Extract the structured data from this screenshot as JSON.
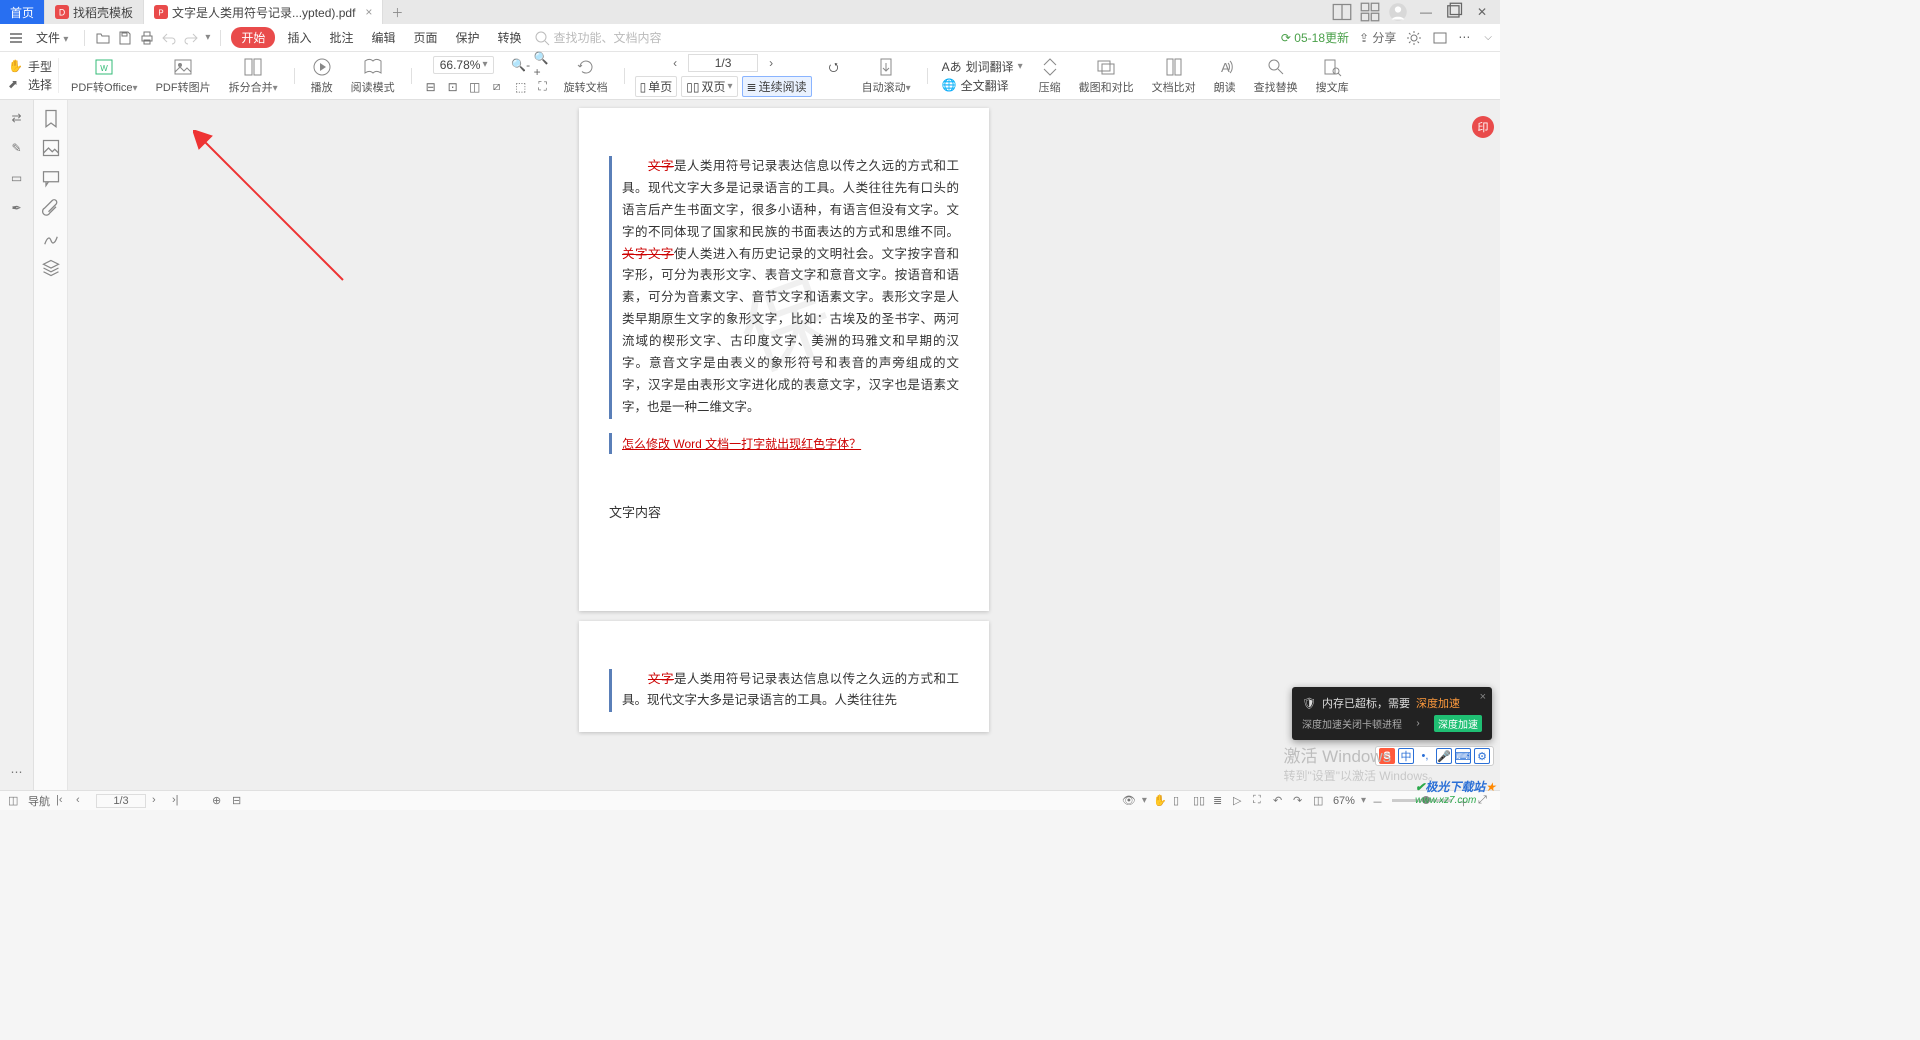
{
  "tabs": {
    "home": "首页",
    "template": "找稻壳模板",
    "doc": "文字是人类用符号记录...ypted).pdf"
  },
  "menubar": {
    "file": "文件",
    "start": "开始",
    "insert": "插入",
    "annot": "批注",
    "edit": "编辑",
    "page": "页面",
    "protect": "保护",
    "convert": "转换",
    "search_ph": "查找功能、文档内容",
    "update": "05-18更新",
    "share": "分享"
  },
  "cursor": {
    "hand": "手型",
    "select": "选择"
  },
  "ribbon": {
    "pdf2office": "PDF转Office",
    "pdf2img": "PDF转图片",
    "splitmerge": "拆分合并",
    "play": "播放",
    "readmode": "阅读模式",
    "rotate": "旋转文档",
    "zoom": "66.78%",
    "page": "1/3",
    "single": "单页",
    "double": "双页",
    "cont": "连续阅读",
    "autoscroll": "自动滚动",
    "wordtrans": "划词翻译",
    "fulltrans": "全文翻译",
    "compress": "压缩",
    "screenshot": "截图和对比",
    "filecompare": "文档比对",
    "readaloud": "朗读",
    "findreplace": "查找替换",
    "soudoc": "搜文库"
  },
  "doc": {
    "para": "是人类用符号记录表达信息以传之久远的方式和工具。现代文字大多是记录语言的工具。人类往往先有口头的语言后产生书面文字，很多小语种，有语言但没有文字。文字的不同体现了国家和民族的书面表达的方式和思维不同。",
    "red1": "文字",
    "red2": "关字文字",
    "para2": "使人类进入有历史记录的文明社会。文字按字音和字形，可分为表形文字、表音文字和意音文字。按语音和语素，可分为音素文字、音节文字和语素文字。表形文字是人类早期原生文字的象形文字，比如：古埃及的圣书字、两河流域的楔形文字、古印度文字、美洲的玛雅文和早期的汉字。意音文字是由表义的象形符号和表音的声旁组成的文字，汉字是由表形文字进化成的表意文字，汉字也是语素文字，也是一种二维文字。",
    "link": "怎么修改 Word 文档一打字就出现红色字体？",
    "body2": "文字内容",
    "watermark": "保",
    "para_p2": "是人类用符号记录表达信息以传之久远的方式和工具。现代文字大多是记录语言的工具。人类往往先"
  },
  "toast": {
    "line1a": "内存已超标，需要 ",
    "line1b": "深度加速",
    "line2": "深度加速关闭卡顿进程",
    "btn": "深度加速"
  },
  "activate": {
    "l1": "激活 Windows",
    "l2": "转到\"设置\"以激活 Windows。"
  },
  "status": {
    "nav": "导航",
    "page": "1/3",
    "zoom": "67%"
  },
  "float_badge": "印"
}
